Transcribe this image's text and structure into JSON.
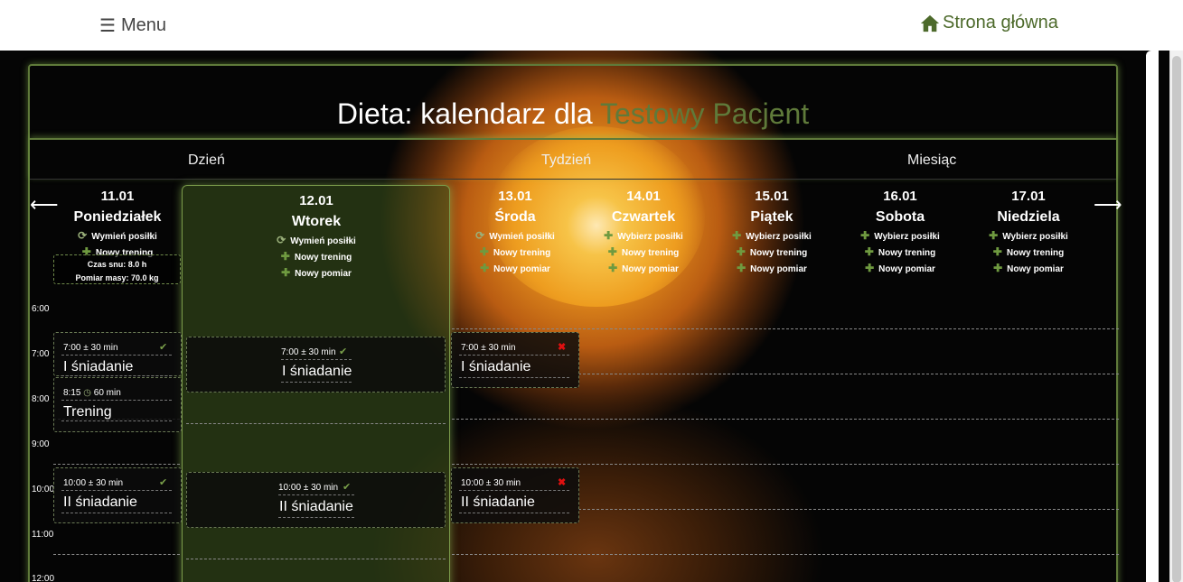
{
  "topbar": {
    "menu_icon": "☰",
    "menu_label": "Menu",
    "home_label": "Strona główna"
  },
  "title": {
    "prefix": "Dieta: kalendarz dla ",
    "patient": "Testowy Pacjent"
  },
  "tabs": [
    "Dzień",
    "Tydzień",
    "Miesiąc"
  ],
  "nav": {
    "prev": "⟵",
    "next": "⟶"
  },
  "days": [
    {
      "date": "11.01",
      "name": "Poniedziałek",
      "actions": [
        "Wymień posiłki",
        "Nowy trening"
      ]
    },
    {
      "date": "12.01",
      "name": "Wtorek",
      "actions": [
        "Wymień posiłki",
        "Nowy trening",
        "Nowy pomiar"
      ]
    },
    {
      "date": "13.01",
      "name": "Środa",
      "actions": [
        "Wymień posiłki",
        "Nowy trening",
        "Nowy pomiar"
      ]
    },
    {
      "date": "14.01",
      "name": "Czwartek",
      "actions": [
        "Wybierz posiłki",
        "Nowy trening",
        "Nowy pomiar"
      ]
    },
    {
      "date": "15.01",
      "name": "Piątek",
      "actions": [
        "Wybierz posiłki",
        "Nowy trening",
        "Nowy pomiar"
      ]
    },
    {
      "date": "16.01",
      "name": "Sobota",
      "actions": [
        "Wybierz posiłki",
        "Nowy trening",
        "Nowy pomiar"
      ]
    },
    {
      "date": "17.01",
      "name": "Niedziela",
      "actions": [
        "Wybierz posiłki",
        "Nowy trening",
        "Nowy pomiar"
      ]
    }
  ],
  "info": {
    "sleep": "Czas snu: 8.0 h",
    "weight": "Pomiar masy: 70.0 kg"
  },
  "hours": [
    "6:00",
    "7:00",
    "8:00",
    "9:00",
    "10:00",
    "11:00",
    "12:00"
  ],
  "entries": {
    "mon_breakfast": {
      "time": "7:00 ± 30 min",
      "name": "I śniadanie",
      "status": "✔"
    },
    "mon_training": {
      "time": "8:15",
      "duration": "60 min",
      "name": "Trening"
    },
    "mon_brunch": {
      "time": "10:00 ± 30 min",
      "name": "II śniadanie",
      "status": "✔"
    },
    "tue_breakfast": {
      "time": "7:00 ± 30 min",
      "name": "I śniadanie",
      "status": "✔"
    },
    "tue_brunch": {
      "time": "10:00 ± 30 min",
      "name": "II śniadanie",
      "status": "✔"
    },
    "wed_breakfast": {
      "time": "7:00 ± 30 min",
      "name": "I śniadanie",
      "status": "✖"
    },
    "wed_brunch": {
      "time": "10:00 ± 30 min",
      "name": "II śniadanie",
      "status": "✖"
    }
  },
  "colors": {
    "accent": "#5f7a3a",
    "check": "#7aa04a",
    "cross": "#e01010"
  }
}
